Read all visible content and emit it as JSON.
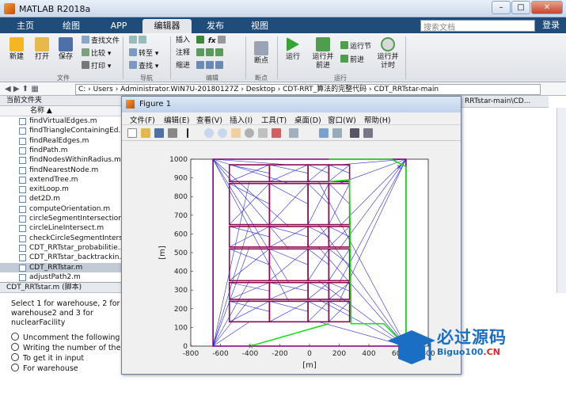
{
  "app": {
    "title": "MATLAB R2018a",
    "login": "登录",
    "search_placeholder": "搜索文档"
  },
  "tabs": [
    "主页",
    "绘图",
    "APP",
    "编辑器",
    "发布",
    "视图"
  ],
  "ribbon": {
    "file": {
      "new": "新建",
      "open": "打开",
      "save": "保存",
      "find_files": "查找文件",
      "compare": "比较",
      "print": "打印",
      "group": "文件"
    },
    "nav": {
      "goto": "转至",
      "find": "查找",
      "group": "导航"
    },
    "edit": {
      "insert": "插入",
      "comment": "注释",
      "indent": "缩进",
      "fx": "fx",
      "group": "编辑"
    },
    "breakpoints": {
      "label": "断点",
      "group": "断点"
    },
    "run": {
      "run": "运行",
      "run_advance": "运行并\n前进",
      "run_section": "运行节",
      "advance": "前进",
      "run_time": "运行并\n计时",
      "group": "运行"
    }
  },
  "address": {
    "path": "C: › Users › Administrator.WIN7U-20180127Z › Desktop › CDT-RRT_算法的完整代码 › CDT_RRTstar-main"
  },
  "current_folder": {
    "title": "当前文件夹",
    "col_name": "名称",
    "files": [
      "findVirtualEdges.m",
      "findTriangleContainingEd...",
      "findRealEdges.m",
      "findPath.m",
      "findNodesWithinRadius.m",
      "findNearestNode.m",
      "extendTree.m",
      "exitLoop.m",
      "det2D.m",
      "computeOrientation.m",
      "circleSegmentIntersection...",
      "circleLineIntersect.m",
      "checkCircleSegmentInters...",
      "CDT_RRTstar_probabilitie...",
      "CDT_RRTstar_backtrackin...",
      "CDT_RRTstar.m",
      "adjustPath2.m"
    ],
    "selected": "CDT_RRTstar.m"
  },
  "details": {
    "label": "CDT_RRTstar.m (脚本)"
  },
  "command": {
    "prompt": "Select 1 for warehouse, 2 for warehouse2 and 3 for nuclearFacility",
    "lines": [
      "Uncomment the following ...",
      "Writing the number of the...",
      "To get it in input",
      "For warehouse"
    ]
  },
  "right_panel": {
    "title": "RRTstar-main\\CD..."
  },
  "figure": {
    "title": "Figure 1",
    "menu": [
      "文件(F)",
      "编辑(E)",
      "查看(V)",
      "插入(I)",
      "工具(T)",
      "桌面(D)",
      "窗口(W)",
      "帮助(H)"
    ]
  },
  "chart_data": {
    "type": "line",
    "xlabel": "[m]",
    "ylabel": "[m]",
    "xlim": [
      -800,
      800
    ],
    "ylim": [
      0,
      1000
    ],
    "xticks": [
      -800,
      -600,
      -400,
      -200,
      0,
      200,
      400,
      600,
      800
    ],
    "yticks": [
      0,
      100,
      200,
      300,
      400,
      500,
      600,
      700,
      800,
      900,
      1000
    ],
    "boundary": [
      [
        -650,
        0
      ],
      [
        650,
        0
      ],
      [
        650,
        1000
      ],
      [
        -650,
        1000
      ]
    ],
    "obstacles": [
      {
        "x": [
          -540,
          -270
        ],
        "y": [
          880,
          970
        ]
      },
      {
        "x": [
          -270,
          -10
        ],
        "y": [
          880,
          970
        ]
      },
      {
        "x": [
          -10,
          130
        ],
        "y": [
          880,
          970
        ]
      },
      {
        "x": [
          130,
          270
        ],
        "y": [
          880,
          970
        ]
      },
      {
        "x": [
          -540,
          -270
        ],
        "y": [
          650,
          870
        ]
      },
      {
        "x": [
          -270,
          -10
        ],
        "y": [
          650,
          870
        ]
      },
      {
        "x": [
          -10,
          130
        ],
        "y": [
          650,
          870
        ]
      },
      {
        "x": [
          130,
          270
        ],
        "y": [
          650,
          870
        ]
      },
      {
        "x": [
          -540,
          -270
        ],
        "y": [
          530,
          640
        ]
      },
      {
        "x": [
          -270,
          -10
        ],
        "y": [
          530,
          640
        ]
      },
      {
        "x": [
          -10,
          130
        ],
        "y": [
          530,
          640
        ]
      },
      {
        "x": [
          130,
          270
        ],
        "y": [
          530,
          640
        ]
      },
      {
        "x": [
          -540,
          -270
        ],
        "y": [
          350,
          520
        ]
      },
      {
        "x": [
          -270,
          -10
        ],
        "y": [
          350,
          520
        ]
      },
      {
        "x": [
          -10,
          130
        ],
        "y": [
          350,
          520
        ]
      },
      {
        "x": [
          130,
          270
        ],
        "y": [
          350,
          520
        ]
      },
      {
        "x": [
          -540,
          -270
        ],
        "y": [
          250,
          340
        ]
      },
      {
        "x": [
          -270,
          -10
        ],
        "y": [
          250,
          340
        ]
      },
      {
        "x": [
          -10,
          130
        ],
        "y": [
          250,
          340
        ]
      },
      {
        "x": [
          130,
          270
        ],
        "y": [
          250,
          340
        ]
      },
      {
        "x": [
          -540,
          -270
        ],
        "y": [
          130,
          240
        ]
      },
      {
        "x": [
          -270,
          -10
        ],
        "y": [
          130,
          240
        ]
      },
      {
        "x": [
          -10,
          130
        ],
        "y": [
          130,
          240
        ]
      },
      {
        "x": [
          130,
          270
        ],
        "y": [
          130,
          240
        ]
      }
    ],
    "start": [
      -400,
      0
    ],
    "goal": [
      600,
      960
    ],
    "colors": {
      "boundary": "#7b007b",
      "obstacle": "#8b0a50",
      "triangulation": "#2b2bd8",
      "path": "#19e019"
    }
  },
  "watermark": {
    "brand": "必过源码",
    "url_prefix": "Biguo100",
    "url_suffix": ".CN"
  }
}
